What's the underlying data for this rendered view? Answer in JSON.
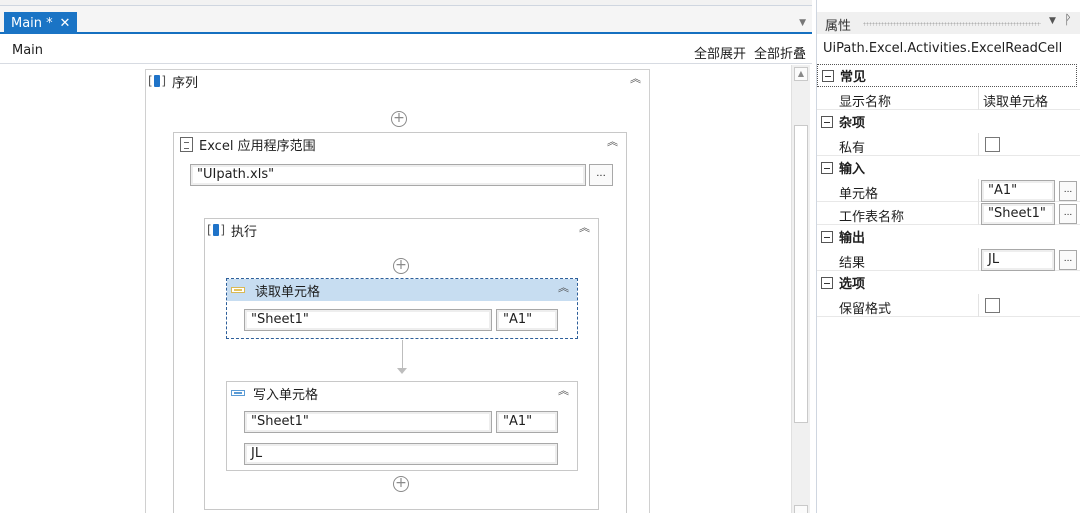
{
  "tabs": {
    "main_label": "Main *",
    "close_glyph": "✕",
    "dropdown_glyph": "▼"
  },
  "breadcrumb": {
    "path": "Main",
    "expand_all": "全部展开",
    "collapse_all": "全部折叠"
  },
  "workflow": {
    "sequence": {
      "title": "序列"
    },
    "excel_scope": {
      "title": "Excel 应用程序范围",
      "workbook_path": "\"UIpath.xls\"",
      "browse_label": "..."
    },
    "execute": {
      "title": "执行"
    },
    "read_cell": {
      "title": "读取单元格",
      "sheet": "\"Sheet1\"",
      "cell": "\"A1\""
    },
    "write_cell": {
      "title": "写入单元格",
      "sheet": "\"Sheet1\"",
      "cell": "\"A1\"",
      "value": "JL"
    }
  },
  "properties": {
    "title": "属性",
    "pin_glyph": "ᚹ",
    "dropdown_glyph": "▼",
    "class_name": "UiPath.Excel.Activities.ExcelReadCell",
    "categories": {
      "common": {
        "label": "常见",
        "display_name_label": "显示名称",
        "display_name_value": "读取单元格"
      },
      "misc": {
        "label": "杂项",
        "private_label": "私有",
        "private_checked": false
      },
      "input": {
        "label": "输入",
        "cell_label": "单元格",
        "cell_value": "\"A1\"",
        "sheet_label": "工作表名称",
        "sheet_value": "\"Sheet1\""
      },
      "output": {
        "label": "输出",
        "result_label": "结果",
        "result_value": "JL"
      },
      "options": {
        "label": "选项",
        "preserve_label": "保留格式",
        "preserve_checked": false
      }
    },
    "ellipsis": "..."
  },
  "colors": {
    "tab_active": "#1a74c5",
    "selected_header": "#c7ddf1",
    "selected_border": "#2d5f9a"
  }
}
